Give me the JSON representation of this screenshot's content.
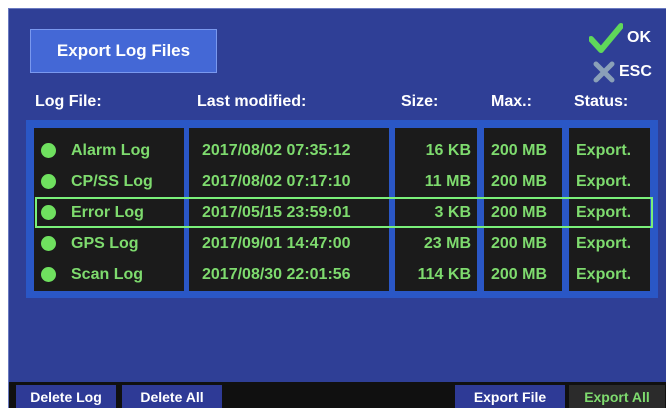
{
  "title_button": "Export Log Files",
  "ok_label": "OK",
  "esc_label": "ESC",
  "columns": {
    "log_file": "Log File:",
    "last_modified": "Last modified:",
    "size": "Size:",
    "max": "Max.:",
    "status": "Status:"
  },
  "rows": [
    {
      "name": "Alarm Log",
      "modified": "2017/08/02 07:35:12",
      "size": "16 KB",
      "max": "200 MB",
      "status": "Export."
    },
    {
      "name": "CP/SS Log",
      "modified": "2017/08/02 07:17:10",
      "size": "11 MB",
      "max": "200 MB",
      "status": "Export."
    },
    {
      "name": "Error Log",
      "modified": "2017/05/15 23:59:01",
      "size": "3 KB",
      "max": "200 MB",
      "status": "Export."
    },
    {
      "name": "GPS Log",
      "modified": "2017/09/01 14:47:00",
      "size": "23 MB",
      "max": "200 MB",
      "status": "Export."
    },
    {
      "name": "Scan Log",
      "modified": "2017/08/30 22:01:56",
      "size": "114 KB",
      "max": "200 MB",
      "status": "Export."
    }
  ],
  "bottom_buttons": {
    "delete_log": "Delete Log",
    "delete_all": "Delete All",
    "export_file": "Export File",
    "export_all": "Export All"
  },
  "colors": {
    "screen_bg": "#2f3f96",
    "accent_green": "#7edb6e",
    "title_btn": "#4468d6"
  },
  "icons": {
    "ok": "checkmark-icon",
    "esc": "x-icon",
    "row_marker": "dot-icon"
  }
}
